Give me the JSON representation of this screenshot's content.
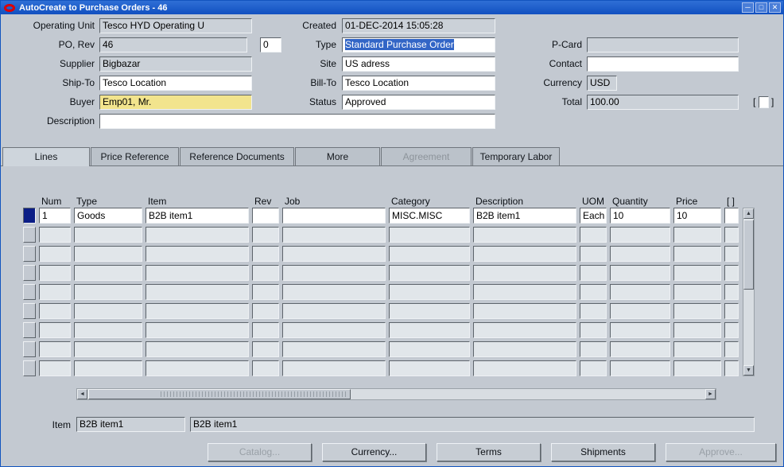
{
  "window": {
    "title": "AutoCreate to Purchase Orders - 46"
  },
  "icons": {
    "minimize": "─",
    "maximize": "□",
    "close": "✕",
    "arrow_up": "▲",
    "arrow_down": "▼",
    "arrow_left": "◄",
    "arrow_right": "►"
  },
  "colors": {
    "titlebar_blue": "#1f5fce",
    "canvas": "#c3c9d1",
    "readonly_field": "#cbd1d8",
    "required_field_yellow": "#f2e48d",
    "selection_blue": "#3265c6",
    "selected_row_navy": "#0b1e86"
  },
  "header": {
    "operating_unit": {
      "label": "Operating Unit",
      "value": "Tesco HYD Operating U"
    },
    "po": {
      "label": "PO, Rev",
      "value": "46",
      "rev": "0"
    },
    "supplier": {
      "label": "Supplier",
      "value": "Bigbazar"
    },
    "ship_to": {
      "label": "Ship-To",
      "value": "Tesco Location"
    },
    "buyer": {
      "label": "Buyer",
      "value": "Emp01, Mr."
    },
    "description": {
      "label": "Description",
      "value": ""
    },
    "created": {
      "label": "Created",
      "value": "01-DEC-2014 15:05:28"
    },
    "type": {
      "label": "Type",
      "value": "Standard Purchase Order"
    },
    "site": {
      "label": "Site",
      "value": "US adress"
    },
    "bill_to": {
      "label": "Bill-To",
      "value": "Tesco Location"
    },
    "status": {
      "label": "Status",
      "value": "Approved"
    },
    "p_card": {
      "label": "P-Card",
      "value": ""
    },
    "contact": {
      "label": "Contact",
      "value": ""
    },
    "currency": {
      "label": "Currency",
      "value": "USD"
    },
    "total": {
      "label": "Total",
      "value": "100.00",
      "bracket_open": "[",
      "bracket_close": "]"
    }
  },
  "tabs": [
    {
      "label": "Lines",
      "active": true,
      "disabled": false
    },
    {
      "label": "Price Reference",
      "active": false,
      "disabled": false
    },
    {
      "label": "Reference Documents",
      "active": false,
      "disabled": false
    },
    {
      "label": "More",
      "active": false,
      "disabled": false
    },
    {
      "label": "Agreement",
      "active": false,
      "disabled": true
    },
    {
      "label": "Temporary Labor",
      "active": false,
      "disabled": false
    }
  ],
  "lines_table": {
    "columns": [
      "Num",
      "Type",
      "Item",
      "Rev",
      "Job",
      "Category",
      "Description",
      "UOM",
      "Quantity",
      "Price",
      "[ ]"
    ],
    "rows": [
      [
        "1",
        "Goods",
        "B2B item1",
        "",
        "",
        "MISC.MISC",
        "B2B item1",
        "Each",
        "10",
        "10",
        ""
      ]
    ],
    "empty_rows": 8
  },
  "footer": {
    "item_label": "Item",
    "item_code": "B2B item1",
    "item_description": "B2B item1"
  },
  "buttons": [
    {
      "label": "Catalog...",
      "disabled": true
    },
    {
      "label": "Currency...",
      "disabled": false
    },
    {
      "label": "Terms",
      "disabled": false
    },
    {
      "label": "Shipments",
      "disabled": false
    },
    {
      "label": "Approve...",
      "disabled": true
    }
  ]
}
